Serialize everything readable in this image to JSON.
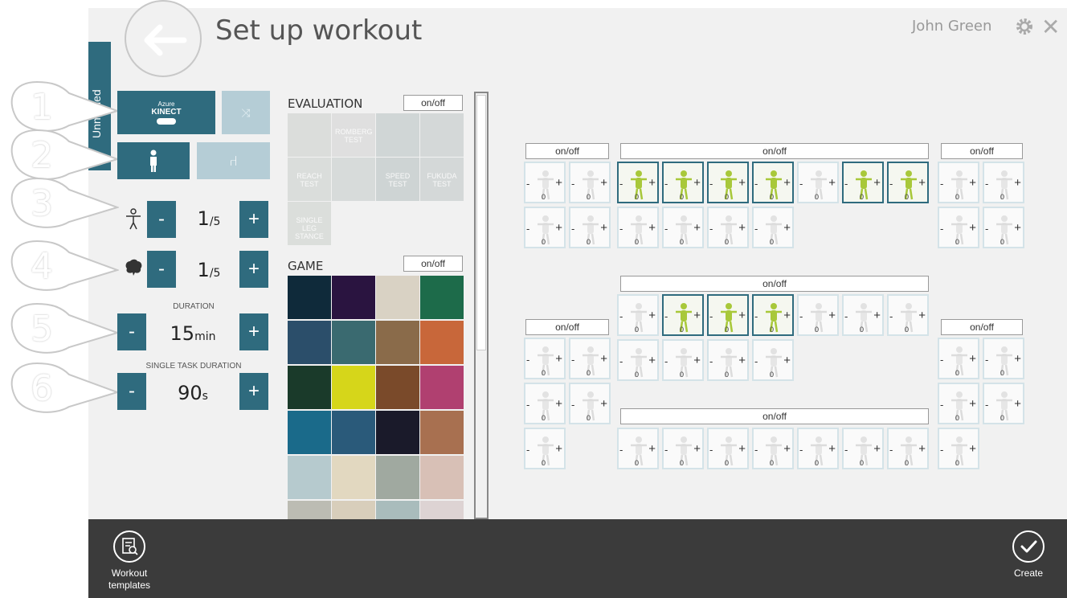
{
  "header": {
    "title": "Set up workout",
    "user": "John Green"
  },
  "sidebar_tab": "Unnamed",
  "callouts": [
    "1",
    "2",
    "3",
    "4",
    "5",
    "6"
  ],
  "settings": {
    "kinect_small": "Azure",
    "kinect_big": "KINECT",
    "tasks_value": "1",
    "tasks_unit": "/5",
    "cognitive_value": "1",
    "cognitive_unit": "/5",
    "duration_label": "DURATION",
    "duration_value": "15",
    "duration_unit": "min",
    "single_label": "SINGLE TASK DURATION",
    "single_value": "90",
    "single_unit": "s",
    "minus": "-",
    "plus": "+"
  },
  "evaluation": {
    "title": "EVALUATION",
    "onoff": "on/off",
    "tiles": [
      "",
      "ROMBERG TEST",
      "",
      "",
      "REACH TEST",
      "",
      "SPEED TEST",
      "FUKUDA TEST",
      "SINGLE LEG STANCE"
    ]
  },
  "game": {
    "title": "GAME",
    "onoff": "on/off"
  },
  "exercises": {
    "onoff": "on/off",
    "count": "0",
    "minus": "-",
    "plus": "+"
  },
  "bottom": {
    "templates": "Workout templates",
    "create": "Create"
  },
  "colors": {
    "accent": "#2f6b7e",
    "accent_light": "#b5cdd6",
    "selected_fig": "#a8c83a"
  }
}
